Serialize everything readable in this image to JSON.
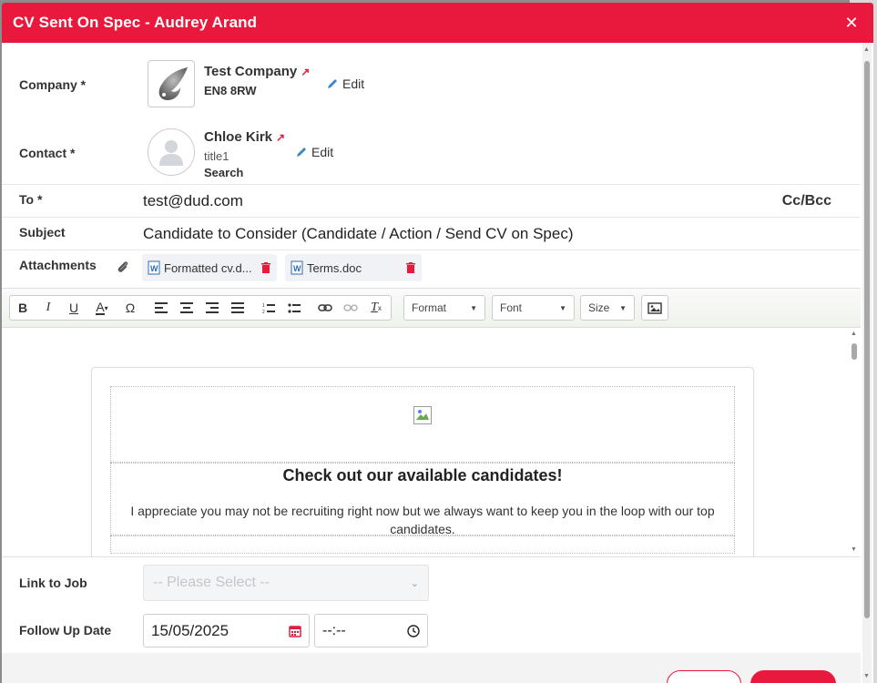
{
  "modal": {
    "title": "CV Sent On Spec - Audrey Arand",
    "close_glyph": "✕"
  },
  "company": {
    "label": "Company *",
    "name": "Test Company",
    "postcode": "EN8 8RW",
    "edit_label": "Edit"
  },
  "contact": {
    "label": "Contact *",
    "name": "Chloe Kirk",
    "title": "title1",
    "search_label": "Search",
    "edit_label": "Edit"
  },
  "to": {
    "label": "To *",
    "value": "test@dud.com",
    "ccbcc_label": "Cc/Bcc"
  },
  "subject": {
    "label": "Subject",
    "value": "Candidate to Consider (Candidate / Action / Send CV on Spec)"
  },
  "attachments": {
    "label": "Attachments",
    "files": [
      {
        "name": "Formatted cv.d..."
      },
      {
        "name": "Terms.doc"
      }
    ]
  },
  "toolbar": {
    "format_label": "Format",
    "font_label": "Font",
    "size_label": "Size",
    "icons": [
      "bold-icon",
      "italic-icon",
      "underline-icon",
      "text-color-icon",
      "special-char-icon",
      "align-left-icon",
      "align-center-icon",
      "align-right-icon",
      "justify-icon",
      "numbered-list-icon",
      "bulleted-list-icon",
      "link-icon",
      "unlink-icon",
      "remove-format-icon",
      "image-icon"
    ]
  },
  "email_body": {
    "headline": "Check out our available candidates!",
    "paragraph": "I appreciate you may not be recruiting right now but we always want to keep you in the loop with our top candidates."
  },
  "link_to_job": {
    "label": "Link to Job",
    "placeholder": "-- Please Select --"
  },
  "follow_up": {
    "label": "Follow Up Date",
    "date": "15/05/2025",
    "time": "--:--"
  },
  "colors": {
    "accent": "#e8193c",
    "edit_pencil": "#3a86c8",
    "doc_blue": "#2b6cb0"
  }
}
